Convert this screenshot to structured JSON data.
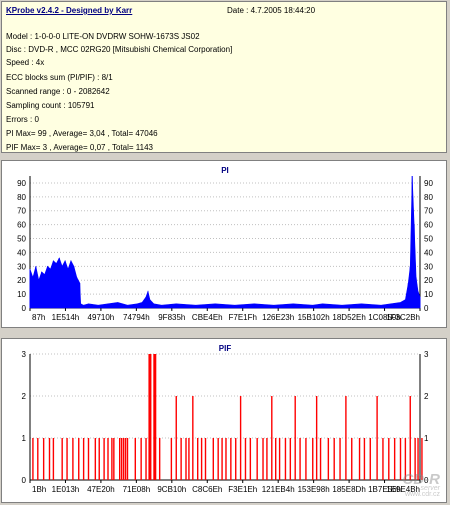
{
  "info": {
    "title": "KProbe v2.4.2 - Designed by Karr",
    "date": "Date : 4.7.2005 18:44:20",
    "lines": [
      "Model : 1-0-0-0 LITE-ON DVDRW SOHW-1673S JS02",
      "Disc : DVD-R , MCC 02RG20  [Mitsubishi Chemical Corporation]",
      "Speed : 4x",
      "ECC blocks sum (PI/PIF) : 8/1",
      "Scanned range : 0 - 2082642",
      "Sampling count : 105791",
      "Errors : 0",
      "PI Max= 99 , Average= 3,04 , Total= 47046",
      "PIF Max= 3 , Average= 0,07 , Total= 1143"
    ]
  },
  "watermark": {
    "main": "CD-R",
    "sub": "server",
    "url": "www.cdr.cz"
  },
  "colors": {
    "bar": "#0000ff",
    "pif_bar": "#ff0000",
    "grid": "#c0c0c0",
    "title": "#000080"
  },
  "chart_data": [
    {
      "type": "area",
      "title": "PI",
      "ylim": [
        0,
        95
      ],
      "y_ticks": [
        "90",
        "80",
        "70",
        "60",
        "50",
        "40",
        "30",
        "20",
        "10",
        "0"
      ],
      "x_tick_labels": [
        "87h",
        "1E514h",
        "49710h",
        "74794h",
        "9F835h",
        "CBE4Eh",
        "F7E1Fh",
        "126E23h",
        "15B102h",
        "18D52Eh",
        "1C0850h",
        "1F3C2Bh"
      ],
      "series": [
        {
          "x": [
            0,
            3,
            6,
            9,
            12,
            15,
            18,
            21,
            24,
            27,
            30,
            33,
            36,
            39,
            42,
            45,
            48,
            51,
            52,
            55,
            60,
            70,
            80,
            90,
            100,
            110,
            115,
            119,
            121,
            123,
            127,
            135,
            150,
            170,
            190,
            210,
            230,
            250,
            270,
            290,
            300,
            320,
            340,
            360,
            380,
            385,
            388,
            390,
            392,
            394,
            396,
            398,
            400
          ],
          "values": [
            28,
            22,
            30,
            20,
            26,
            24,
            30,
            28,
            34,
            32,
            36,
            30,
            34,
            28,
            34,
            30,
            22,
            18,
            3,
            2,
            3,
            2,
            3,
            4,
            2,
            3,
            4,
            8,
            12,
            6,
            3,
            2,
            3,
            2,
            3,
            2,
            3,
            2,
            3,
            2,
            3,
            2,
            3,
            2,
            4,
            6,
            18,
            30,
            99,
            60,
            22,
            12,
            8
          ]
        }
      ]
    },
    {
      "type": "bar",
      "title": "PIF",
      "ylim": [
        0,
        3
      ],
      "y_ticks": [
        "3",
        "2",
        "1",
        "0"
      ],
      "x_tick_labels": [
        "1Bh",
        "1E013h",
        "47E20h",
        "71E08h",
        "9CB10h",
        "C8C6Eh",
        "F3E1Eh",
        "121EB4h",
        "153E98h",
        "185E8Dh",
        "1B7E56h",
        "1E9E4Bh"
      ],
      "series": [
        {
          "x": [
            3,
            8,
            14,
            20,
            24,
            33,
            38,
            44,
            50,
            55,
            60,
            67,
            71,
            76,
            80,
            84,
            86,
            92,
            94,
            96,
            98,
            100,
            108,
            114,
            119,
            123,
            128,
            133,
            145,
            150,
            155,
            160,
            163,
            167,
            172,
            176,
            180,
            188,
            193,
            197,
            201,
            206,
            211,
            216,
            221,
            226,
            233,
            239,
            243,
            248,
            252,
            256,
            262,
            267,
            272,
            277,
            283,
            290,
            294,
            298,
            306,
            312,
            318,
            324,
            330,
            338,
            343,
            349,
            356,
            362,
            368,
            374,
            380,
            385,
            390,
            395,
            398,
            402
          ],
          "values": [
            1,
            1,
            1,
            1,
            1,
            1,
            1,
            1,
            1,
            1,
            1,
            1,
            1,
            1,
            1,
            1,
            1,
            1,
            1,
            1,
            1,
            1,
            1,
            1,
            1,
            3,
            3,
            1,
            1,
            2,
            1,
            1,
            1,
            2,
            1,
            1,
            1,
            1,
            1,
            1,
            1,
            1,
            1,
            2,
            1,
            1,
            1,
            1,
            1,
            2,
            1,
            1,
            1,
            1,
            2,
            1,
            1,
            1,
            2,
            1,
            1,
            1,
            1,
            2,
            1,
            1,
            1,
            1,
            2,
            1,
            1,
            1,
            1,
            1,
            2,
            1,
            1,
            1
          ]
        }
      ]
    }
  ]
}
